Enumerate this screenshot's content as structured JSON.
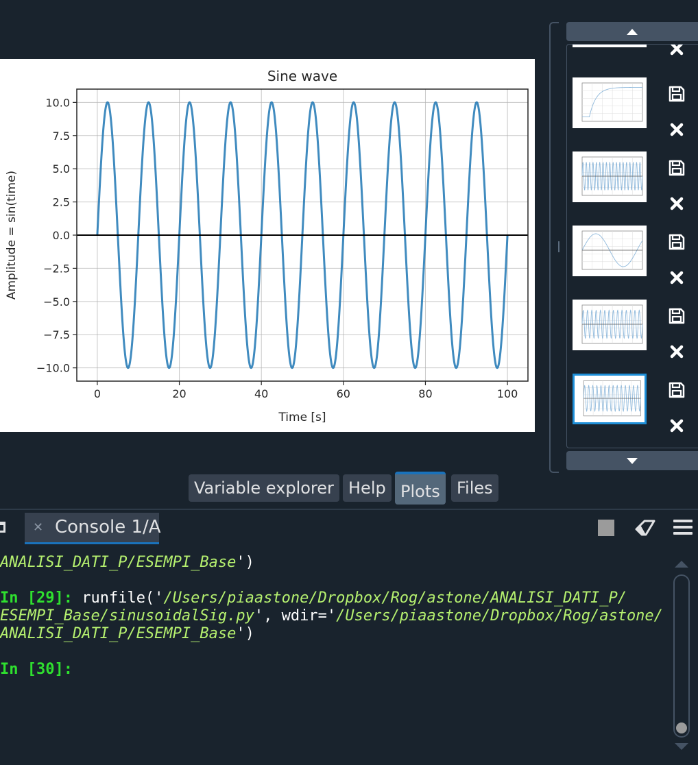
{
  "pane_tabs": [
    {
      "label": "Variable explorer"
    },
    {
      "label": "Help"
    },
    {
      "label": "Plots",
      "active": true
    },
    {
      "label": "Files"
    }
  ],
  "console": {
    "tab_label": "Console 1/A",
    "lines": [
      {
        "segments": [
          {
            "cls": "path",
            "text": "ANALISI_DATI_P/ESEMPI_Base"
          },
          {
            "cls": "code",
            "text": "')"
          }
        ]
      },
      {
        "segments": [
          {
            "cls": "prompt",
            "text": "In [29]: "
          },
          {
            "cls": "code",
            "text": "runfile('"
          },
          {
            "cls": "path",
            "text": "/Users/piaastone/Dropbox/Rog/astone/ANALISI_DATI_P/"
          }
        ]
      },
      {
        "segments": [
          {
            "cls": "path",
            "text": "ESEMPI_Base/sinusoidalSig.py"
          },
          {
            "cls": "code",
            "text": "', wdir='"
          },
          {
            "cls": "path",
            "text": "/Users/piaastone/Dropbox/Rog/astone/"
          }
        ]
      },
      {
        "segments": [
          {
            "cls": "path",
            "text": "ANALISI_DATI_P/ESEMPI_Base"
          },
          {
            "cls": "code",
            "text": "')"
          }
        ]
      },
      {
        "segments": [
          {
            "cls": "prompt",
            "text": "In [30]:"
          }
        ]
      }
    ]
  },
  "thumbnails": {
    "count": 6,
    "selected_index": 5,
    "icons": [
      "save-icon",
      "close-icon"
    ]
  },
  "chart_data": {
    "type": "line",
    "title": "Sine wave",
    "xlabel": "Time [s]",
    "ylabel": "Amplitude = sin(time)",
    "xlim": [
      -5,
      105
    ],
    "ylim": [
      -11,
      11
    ],
    "xticks": [
      0,
      20,
      40,
      60,
      80,
      100
    ],
    "yticks": [
      10.0,
      7.5,
      5.0,
      2.5,
      0.0,
      -2.5,
      -5.0,
      -7.5,
      -10.0
    ],
    "ytick_labels": [
      "10.0",
      "7.5",
      "5.0",
      "2.5",
      "0.0",
      "−2.5",
      "−5.0",
      "−7.5",
      "−10.0"
    ],
    "grid": true,
    "series": [
      {
        "function": "10*sin(2*pi*0.1*t)",
        "amplitude": 10,
        "frequency_hz": 0.1,
        "x_start": 0,
        "x_end": 100,
        "color": "#1f77b4"
      }
    ],
    "hline": {
      "y": 0,
      "color": "#000000"
    }
  }
}
